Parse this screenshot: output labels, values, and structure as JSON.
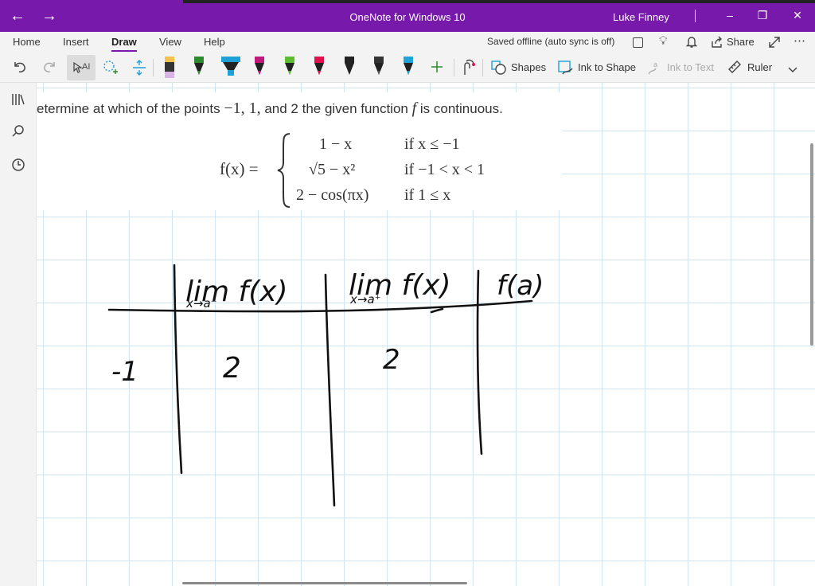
{
  "window": {
    "title": "OneNote for Windows 10",
    "user": "Luke Finney",
    "back_icon": "←",
    "forward_icon": "→",
    "minimize_icon": "–",
    "restore_icon": "❐",
    "close_icon": "✕"
  },
  "ribbon": {
    "tabs": [
      "Home",
      "Insert",
      "Draw",
      "View",
      "Help"
    ],
    "active_tab": "Draw",
    "status": "Saved offline (auto sync is off)",
    "share_label": "Share",
    "more_icon": "⋯"
  },
  "toolbar": {
    "shapes_label": "Shapes",
    "ink_to_shape_label": "Ink to Shape",
    "ink_to_text_label": "Ink to Text",
    "ruler_label": "Ruler",
    "pen_colors": [
      "#f2c14e",
      "#2d8a2d",
      "#1e9fd6",
      "#c2177b",
      "#5bbd2f",
      "#e0124d",
      "#222222",
      "#333333",
      "#1fa3d8"
    ]
  },
  "problem": {
    "lead": "etermine at which of the points",
    "points": "−1, 1,",
    "and": "and 2 the given function",
    "fname": "f",
    "tail": "is continuous.",
    "lhs": "f(x) =",
    "cases": [
      {
        "expr": "1 − x",
        "cond": "if x ≤ −1"
      },
      {
        "expr": "√5 − x²",
        "cond": "if −1 < x < 1"
      },
      {
        "expr": "2 − cos(πx)",
        "cond": "if 1 ≤ x"
      }
    ]
  },
  "handwriting": {
    "col1_header": "lim f(x)",
    "col1_sub": "x→a⁻",
    "col2_header": "lim f(x)",
    "col2_sub": "x→a⁺",
    "col3_header": "f(a)",
    "row_label": "-1",
    "row_val1": "2",
    "row_val2": "2"
  }
}
